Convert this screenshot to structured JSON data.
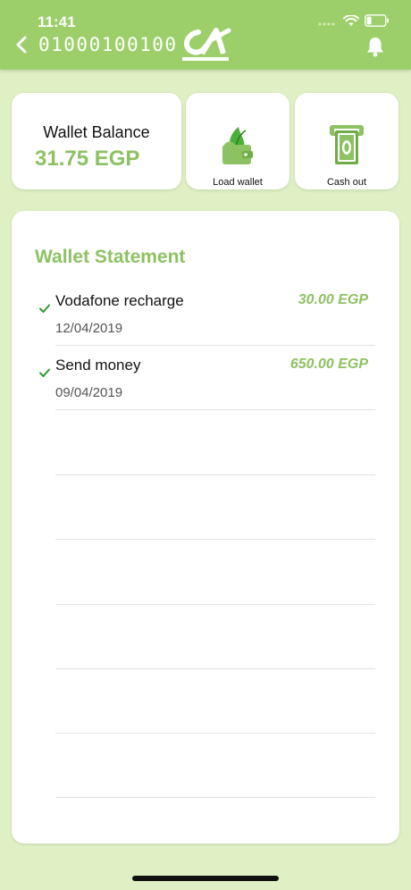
{
  "status_bar": {
    "time": "11:41"
  },
  "header": {
    "account_number": "01000100100"
  },
  "balance": {
    "label": "Wallet Balance",
    "value": "31.75 EGP"
  },
  "actions": [
    {
      "label": "Load wallet",
      "icon": "wallet-leaf-icon"
    },
    {
      "label": "Cash out",
      "icon": "cash-out-icon"
    }
  ],
  "statement": {
    "title": "Wallet Statement",
    "transactions": [
      {
        "description": "Vodafone recharge",
        "date": "12/04/2019",
        "amount": "30.00 EGP",
        "status": "completed"
      },
      {
        "description": "Send money",
        "date": "09/04/2019",
        "amount": "650.00 EGP",
        "status": "completed"
      }
    ]
  },
  "colors": {
    "brand_green": "#9ccf6a",
    "accent_green": "#8dc263",
    "background": "#dff0c4",
    "check_green": "#2e9a2e"
  }
}
